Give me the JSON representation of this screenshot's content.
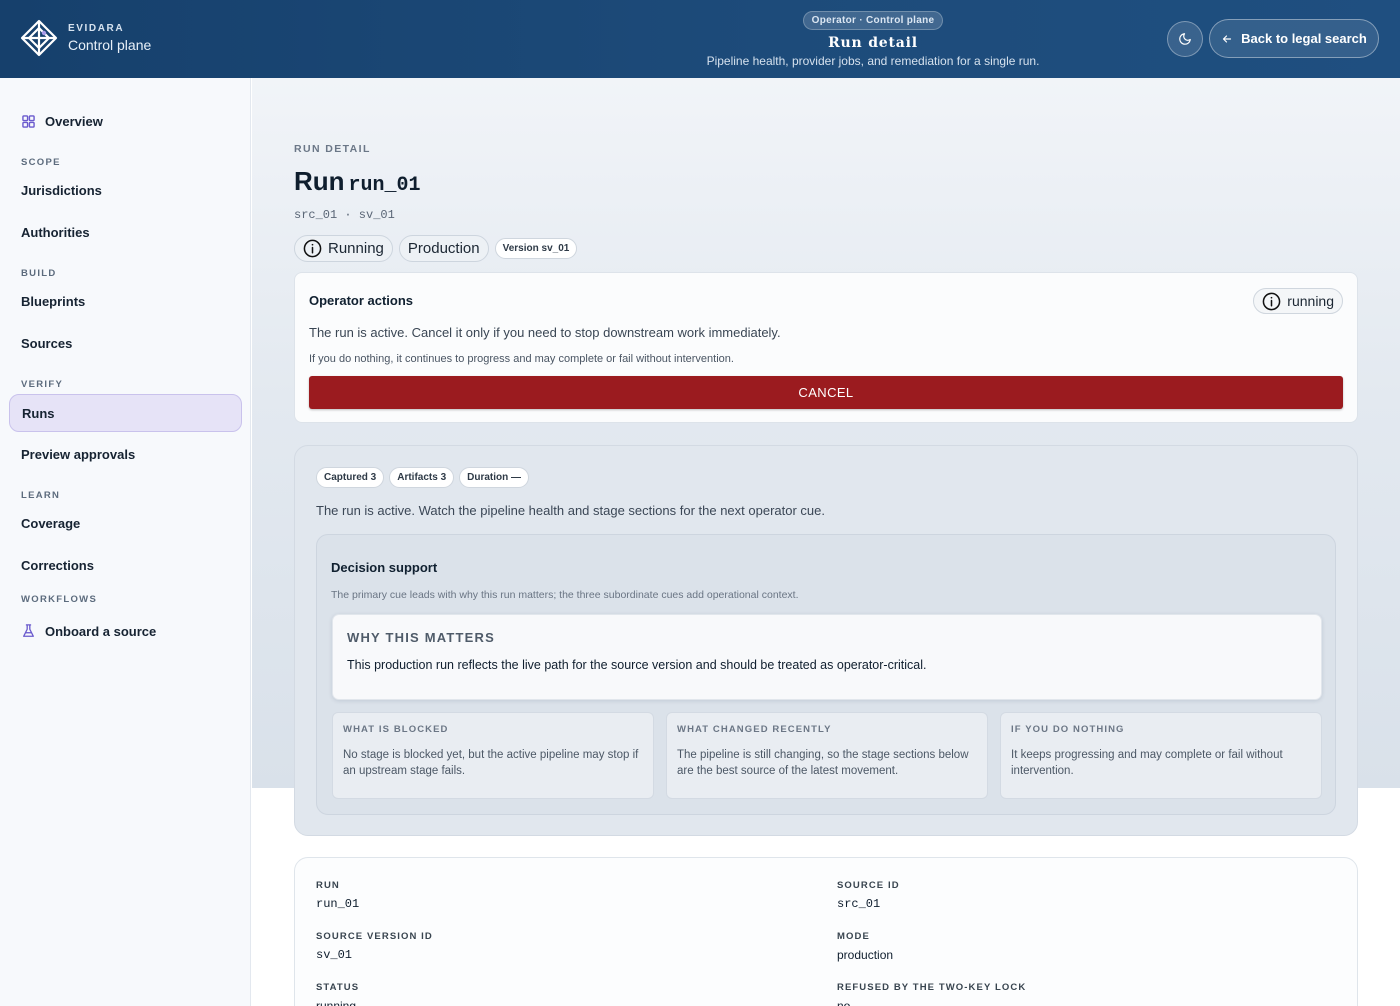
{
  "header": {
    "brand_kicker": "EVIDARA",
    "brand_name": "Control plane",
    "pill": "Operator · Control plane",
    "title": "Run detail",
    "subtitle": "Pipeline health, provider jobs, and remediation for a single run.",
    "back_label": "Back to legal search"
  },
  "sidebar": {
    "overview": "Overview",
    "sections": {
      "scope": "SCOPE",
      "build": "BUILD",
      "verify": "VERIFY",
      "learn": "LEARN",
      "workflows": "WORKFLOWS"
    },
    "items": {
      "jurisdictions": "Jurisdictions",
      "authorities": "Authorities",
      "blueprints": "Blueprints",
      "sources": "Sources",
      "runs": "Runs",
      "preview_approvals": "Preview approvals",
      "coverage": "Coverage",
      "corrections": "Corrections",
      "onboard": "Onboard a source"
    },
    "accent_color": "#6a5acd"
  },
  "page": {
    "kicker": "RUN DETAIL",
    "title_prefix": "Run",
    "run_id": "run_01",
    "ids_line": "src_01 · sv_01",
    "status_chip": "Running",
    "mode_chip": "Production",
    "version_chip": "Version sv_01"
  },
  "operator": {
    "title": "Operator actions",
    "badge": "running",
    "description": "The run is active. Cancel it only if you need to stop downstream work immediately.",
    "note": "If you do nothing, it continues to progress and may complete or fail without intervention.",
    "cancel_label": "CANCEL",
    "cancel_color": "#9b1b1f"
  },
  "summary": {
    "chips": {
      "captured": "Captured 3",
      "artifacts": "Artifacts 3",
      "duration": "Duration —"
    },
    "description": "The run is active. Watch the pipeline health and stage sections for the next operator cue.",
    "decision": {
      "title": "Decision support",
      "subtitle": "The primary cue leads with why this run matters; the three subordinate cues add operational context.",
      "why_kicker": "WHY THIS MATTERS",
      "why_text": "This production run reflects the live path for the source version and should be treated as operator-critical.",
      "cues": [
        {
          "title": "WHAT IS BLOCKED",
          "text": "No stage is blocked yet, but the active pipeline may stop if an upstream stage fails."
        },
        {
          "title": "WHAT CHANGED RECENTLY",
          "text": "The pipeline is still changing, so the stage sections below are the best source of the latest movement."
        },
        {
          "title": "IF YOU DO NOTHING",
          "text": "It keeps progressing and may complete or fail without intervention."
        }
      ]
    }
  },
  "details": {
    "run_label": "RUN",
    "run_value": "run_01",
    "source_id_label": "SOURCE ID",
    "source_id_value": "src_01",
    "source_version_label": "SOURCE VERSION ID",
    "source_version_value": "sv_01",
    "mode_label": "MODE",
    "mode_value": "production",
    "status_label": "STATUS",
    "status_value": "running",
    "refused_label": "REFUSED BY THE TWO-KEY LOCK",
    "refused_value": "no"
  }
}
